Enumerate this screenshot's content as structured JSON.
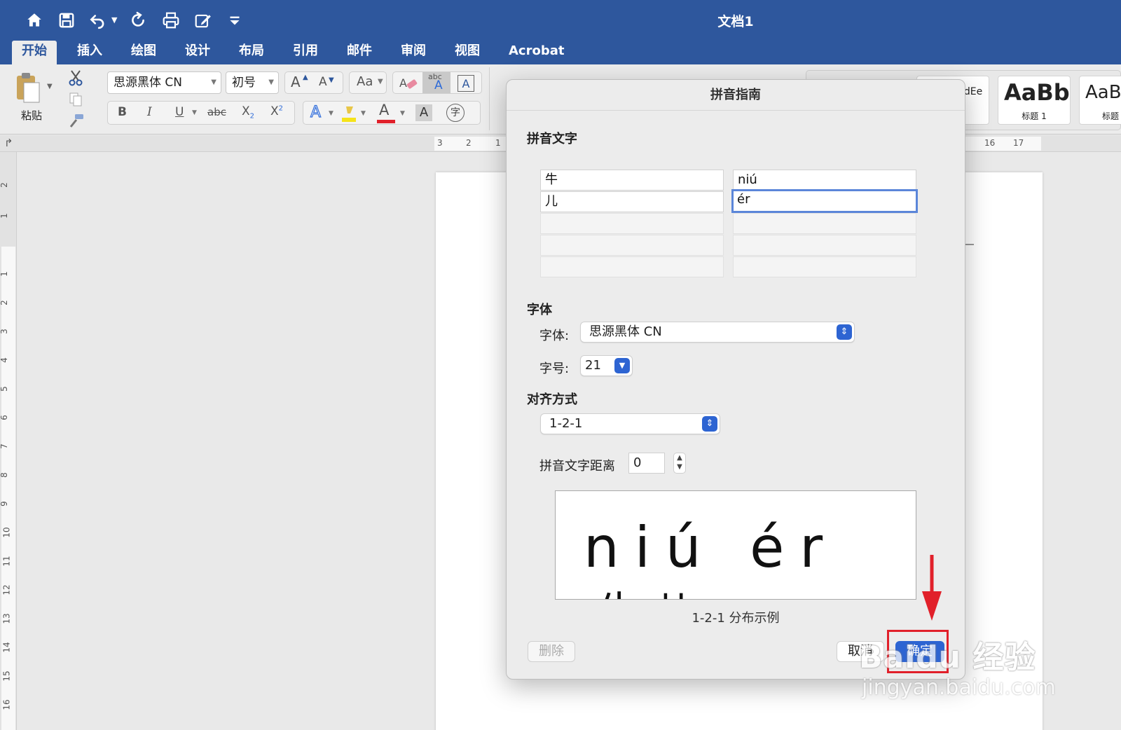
{
  "titlebar": {
    "title": "文档1",
    "quick_access": [
      "home-icon",
      "save-icon",
      "undo-icon",
      "redo-icon",
      "print-icon",
      "edit-icon",
      "customize-icon"
    ]
  },
  "tabs": [
    "开始",
    "插入",
    "绘图",
    "设计",
    "布局",
    "引用",
    "邮件",
    "审阅",
    "视图",
    "Acrobat"
  ],
  "active_tab": "开始",
  "ribbon": {
    "paste_label": "粘贴",
    "font_name": "思源黑体 CN",
    "font_size": "初号",
    "grow_font": "A",
    "shrink_font": "A",
    "change_case": "Aa",
    "bold": "B",
    "italic": "I",
    "underline": "U",
    "strikethrough": "abc",
    "subscript": "X",
    "subscript_mark": "2",
    "superscript": "X",
    "superscript_mark": "2",
    "text_effects": "A",
    "font_color": "A",
    "char_shading": "A",
    "enclose_char": "字",
    "phonetic_guide": "abc",
    "styles": [
      {
        "preview": "AaBbCcDdEe",
        "name": ""
      },
      {
        "preview": "AaBbC",
        "name": "标题 1"
      },
      {
        "preview": "AaBb",
        "name": "标题"
      }
    ],
    "accent_color": "#2e579d",
    "highlight_color": "#f5e31a",
    "font_color_bar": "#e1202a"
  },
  "ruler": {
    "h_numbers": [
      "3",
      "2",
      "1",
      "16",
      "17"
    ],
    "v_numbers": [
      "2",
      "1",
      "1",
      "2",
      "3",
      "4",
      "5",
      "6",
      "7",
      "8",
      "9",
      "10",
      "11",
      "12",
      "13",
      "14",
      "15",
      "16"
    ]
  },
  "dialog": {
    "title": "拼音指南",
    "section_text": "拼音文字",
    "rows": [
      {
        "base": "牛",
        "ruby": "niú"
      },
      {
        "base": "儿",
        "ruby": "ér"
      },
      {
        "base": "",
        "ruby": ""
      },
      {
        "base": "",
        "ruby": ""
      },
      {
        "base": "",
        "ruby": ""
      }
    ],
    "section_font": "字体",
    "font_label": "字体:",
    "font_value": "思源黑体 CN",
    "size_label": "字号:",
    "size_value": "21",
    "section_align": "对齐方式",
    "align_value": "1-2-1",
    "offset_label": "拼音文字距离",
    "offset_value": "0",
    "preview_ruby": "niú ér",
    "preview_base": "牛  儿",
    "preview_caption": "1-2-1 分布示例",
    "delete_label": "删除",
    "cancel_label": "取消",
    "ok_label": "确定",
    "accent_color": "#2d64d2"
  },
  "annotation": {
    "arrow_color": "#e1202a",
    "box_color": "#e1202a"
  },
  "watermark": {
    "brand": "Baidu 经验",
    "url": "jingyan.baidu.com"
  }
}
